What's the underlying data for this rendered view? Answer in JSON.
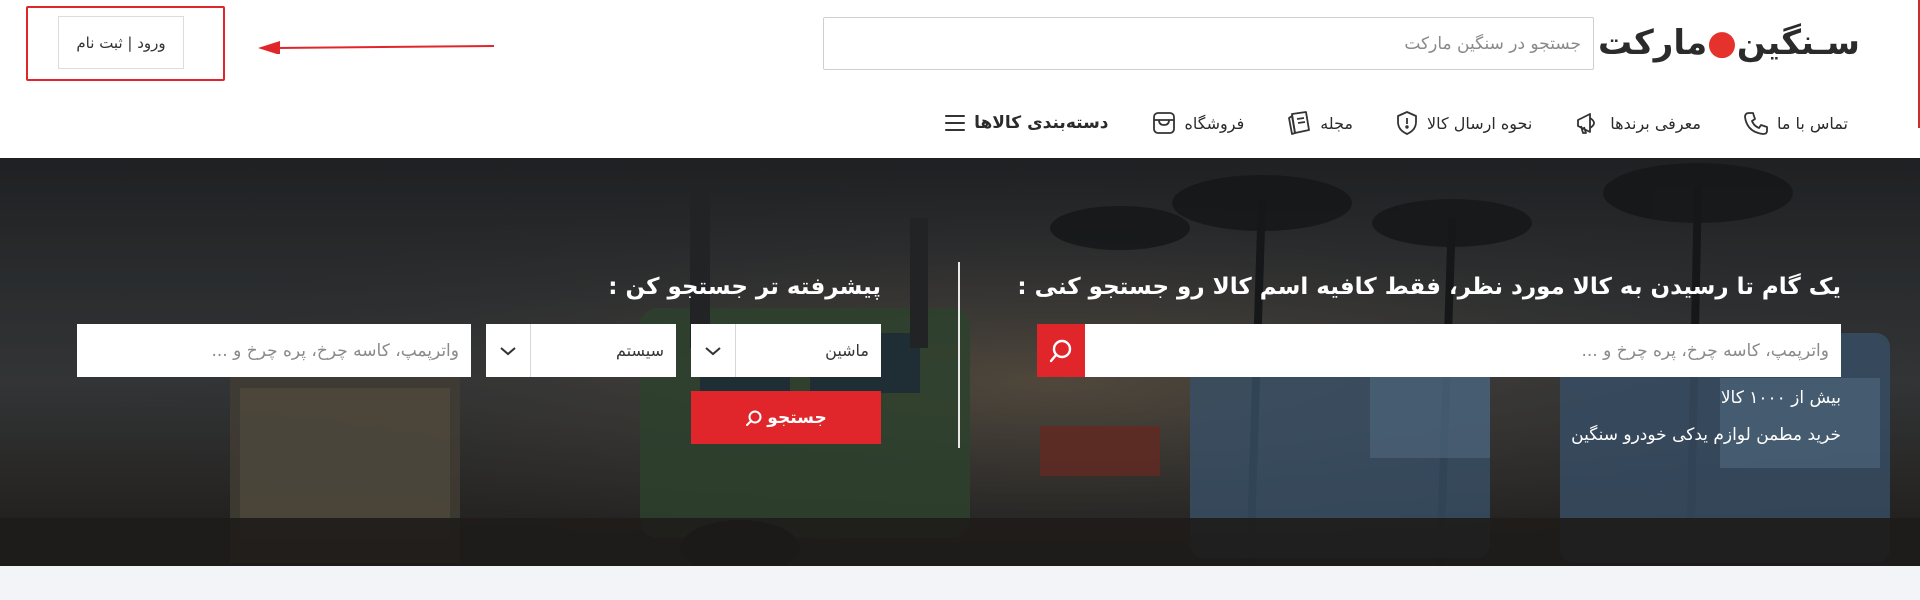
{
  "header": {
    "logo_text_main": "سـنگین",
    "logo_text_tail": "مارکت",
    "search_placeholder": "جستجو در سنگین مارکت",
    "login_label": "ورود | ثبت نام"
  },
  "nav": {
    "items": [
      {
        "label": "دسته‌بندی کالاها",
        "icon": "menu-icon"
      },
      {
        "label": "فروشگاه",
        "icon": "shop-icon"
      },
      {
        "label": "مجله",
        "icon": "magazine-icon"
      },
      {
        "label": "نحوه ارسال کالا",
        "icon": "shield-icon"
      },
      {
        "label": "معرفی برندها",
        "icon": "megaphone-icon"
      },
      {
        "label": "تماس با ما",
        "icon": "phone-icon"
      }
    ]
  },
  "hero": {
    "quick_title": "یک گام تا رسیدن به کالا مورد نظر، فقط کافیه اسم کالا رو جستجو کنی :",
    "quick_search_placeholder": "واترپمپ، کاسه چرخ، پره چرخ و ...",
    "stat_line_1": "بیش از ۱۰۰۰ کالا",
    "stat_line_2": "خرید مطمن لوازم یدکی خودرو سنگین",
    "advanced_title": "پیشرفته تر جستجو کن :",
    "machine_select_value": "ماشین",
    "system_select_value": "سیستم",
    "advanced_input_placeholder": "واترپمپ، کاسه چرخ، پره چرخ و ...",
    "advanced_search_label": "جستجو"
  },
  "colors": {
    "accent": "#e0262b",
    "annotation": "#e0262b",
    "text_dark": "#2b2b2b"
  }
}
